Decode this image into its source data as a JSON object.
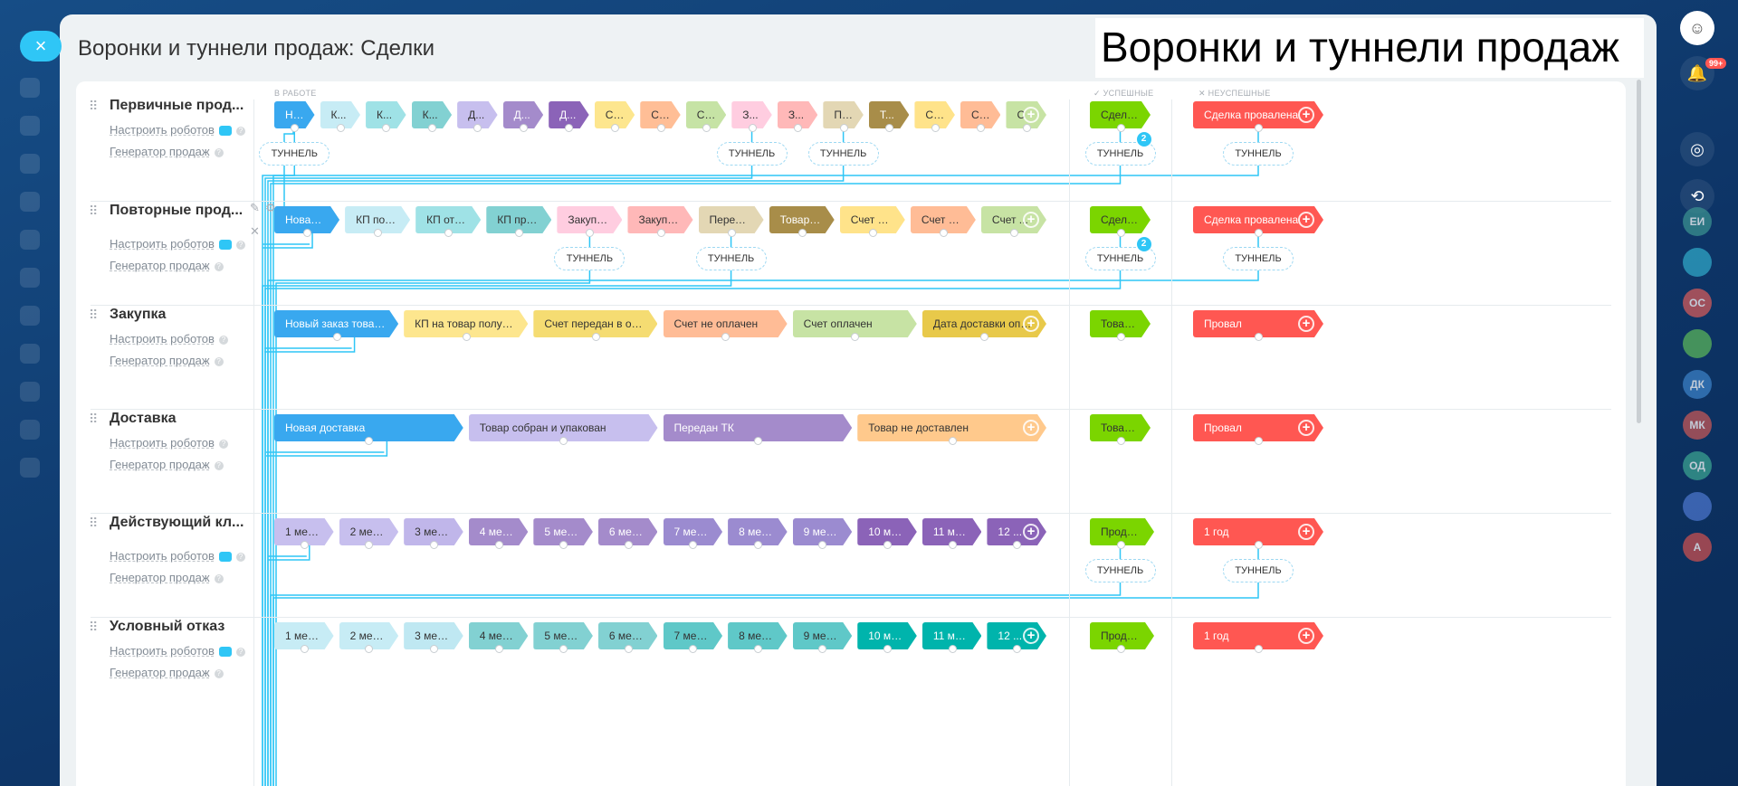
{
  "panel": {
    "title": "Воронки и туннели продаж: Сделки",
    "overlay_title": "Воронки и туннели продаж"
  },
  "columns": {
    "in_work": "В РАБОТЕ",
    "success": "УСПЕШНЫЕ",
    "fail": "НЕУСПЕШНЫЕ"
  },
  "links": {
    "robots": "Настроить роботов",
    "generator": "Генератор продаж"
  },
  "tunnel_label": "ТУННЕЛЬ",
  "bell_count": "99+",
  "right_avatars": [
    {
      "label": "ЕИ",
      "color": "#3a8f8f"
    },
    {
      "label": "",
      "color": "#2fa6c6"
    },
    {
      "label": "ОС",
      "color": "#d05a5a"
    },
    {
      "label": "",
      "color": "#58b359"
    },
    {
      "label": "ДК",
      "color": "#3a7fc4"
    },
    {
      "label": "МК",
      "color": "#c25757"
    },
    {
      "label": "ОД",
      "color": "#3aa08f"
    },
    {
      "label": "",
      "color": "#4a74c9"
    },
    {
      "label": "А",
      "color": "#c85050"
    }
  ],
  "funnels": [
    {
      "name": "Первичные прод...",
      "stages": [
        {
          "label": "Н...",
          "color": "#39a8ef"
        },
        {
          "label": "К...",
          "color": "#c7ecf5"
        },
        {
          "label": "К...",
          "color": "#9fe2e6"
        },
        {
          "label": "К...",
          "color": "#82d1d2"
        },
        {
          "label": "Д...",
          "color": "#c7bfee"
        },
        {
          "label": "Д...",
          "color": "#a48bcb"
        },
        {
          "label": "Д...",
          "color": "#8b63b8"
        },
        {
          "label": "С...",
          "color": "#fde68e"
        },
        {
          "label": "С...",
          "color": "#ffbe96"
        },
        {
          "label": "С...",
          "color": "#c6e3a5"
        },
        {
          "label": "З...",
          "color": "#ffcde0"
        },
        {
          "label": "З...",
          "color": "#ffb8b8"
        },
        {
          "label": "П...",
          "color": "#e3d7b4"
        },
        {
          "label": "Т...",
          "color": "#a88d49"
        },
        {
          "label": "С...",
          "color": "#ffe38a"
        },
        {
          "label": "С...",
          "color": "#ffbc96"
        },
        {
          "label": "С",
          "color": "#c7e3a4"
        }
      ],
      "success": {
        "label": "Сделка ...",
        "color": "#7bd500"
      },
      "fail": {
        "label": "Сделка провалена",
        "color": "#ff5752"
      }
    },
    {
      "name": "Повторные прод...",
      "stages": [
        {
          "label": "Новая ...",
          "color": "#39a8ef"
        },
        {
          "label": "КП под...",
          "color": "#c7ecf5"
        },
        {
          "label": "КП отп...",
          "color": "#9fe2e6"
        },
        {
          "label": "КП при...",
          "color": "#82d1d2"
        },
        {
          "label": "Закупк...",
          "color": "#ffcde0"
        },
        {
          "label": "Закупк...",
          "color": "#ffb8b8"
        },
        {
          "label": "Переда...",
          "color": "#e3d7b4"
        },
        {
          "label": "Товар д...",
          "color": "#a88d49"
        },
        {
          "label": "Счет на...",
          "color": "#ffe38a"
        },
        {
          "label": "Счет на...",
          "color": "#ffbc96"
        },
        {
          "label": "Счет ...",
          "color": "#c7e3a4"
        }
      ],
      "success": {
        "label": "Сделка ...",
        "color": "#7bd500"
      },
      "fail": {
        "label": "Сделка провалена",
        "color": "#ff5752"
      }
    },
    {
      "name": "Закупка",
      "stages": [
        {
          "label": "Новый заказ товара",
          "color": "#39a8ef"
        },
        {
          "label": "КП на товар получено",
          "color": "#fde68e"
        },
        {
          "label": "Счет передан в оплату",
          "color": "#f5dc72"
        },
        {
          "label": "Счет не оплачен",
          "color": "#ffbc96"
        },
        {
          "label": "Счет оплачен",
          "color": "#c7e3a4"
        },
        {
          "label": "Дата доставки опр...",
          "color": "#e8c94a"
        }
      ],
      "success": {
        "label": "Товар н...",
        "color": "#7bd500"
      },
      "fail": {
        "label": "Провал",
        "color": "#ff5752"
      }
    },
    {
      "name": "Доставка",
      "stages": [
        {
          "label": "Новая доставка",
          "color": "#39a8ef"
        },
        {
          "label": "Товар собран и упакован",
          "color": "#c7bfee"
        },
        {
          "label": "Передан ТК",
          "color": "#a48bcb"
        },
        {
          "label": "Товар не доставлен",
          "color": "#ffc98c"
        }
      ],
      "success": {
        "label": "Товар д...",
        "color": "#7bd500"
      },
      "fail": {
        "label": "Провал",
        "color": "#ff5752"
      }
    },
    {
      "name": "Действующий кл...",
      "stages": [
        {
          "label": "1 месяц",
          "color": "#c7bfee"
        },
        {
          "label": "2 месяц",
          "color": "#c7bfee"
        },
        {
          "label": "3 месяц",
          "color": "#c0b6ea"
        },
        {
          "label": "4 месяц",
          "color": "#a48bcb"
        },
        {
          "label": "5 месяц",
          "color": "#a48bcb"
        },
        {
          "label": "6 месяц",
          "color": "#a48bcb"
        },
        {
          "label": "7 месяц",
          "color": "#9b8bd0"
        },
        {
          "label": "8 месяц",
          "color": "#9b8bd0"
        },
        {
          "label": "9 месяц",
          "color": "#9b8bd0"
        },
        {
          "label": "10 мес...",
          "color": "#8b63b8"
        },
        {
          "label": "11 мес...",
          "color": "#8b63b8"
        },
        {
          "label": "12 ...",
          "color": "#8b63b8"
        }
      ],
      "success": {
        "label": "Продажа",
        "color": "#7bd500"
      },
      "fail": {
        "label": "1 год",
        "color": "#ff5752"
      }
    },
    {
      "name": "Условный отказ",
      "stages": [
        {
          "label": "1 месяц",
          "color": "#c7ecf5"
        },
        {
          "label": "2 месяц",
          "color": "#c7ecf5"
        },
        {
          "label": "3 месяц",
          "color": "#bfe8f2"
        },
        {
          "label": "4 месяц",
          "color": "#82d1d2"
        },
        {
          "label": "5 месяц",
          "color": "#82d1d2"
        },
        {
          "label": "6 месяц",
          "color": "#82d1d2"
        },
        {
          "label": "7 месяц",
          "color": "#5fc8c8"
        },
        {
          "label": "8 месяц",
          "color": "#5fc8c8"
        },
        {
          "label": "9 месяц",
          "color": "#5fc8c8"
        },
        {
          "label": "10 мес...",
          "color": "#00b4ac"
        },
        {
          "label": "11 мес...",
          "color": "#00b4ac"
        },
        {
          "label": "12 ...",
          "color": "#00b4ac"
        }
      ],
      "success": {
        "label": "Продажа",
        "color": "#7bd500"
      },
      "fail": {
        "label": "1 год",
        "color": "#ff5752"
      }
    }
  ],
  "tunnels": [
    {
      "row": 0,
      "stage": "0",
      "badge": ""
    },
    {
      "row": 0,
      "stage": "10",
      "badge": ""
    },
    {
      "row": 0,
      "stage": "12",
      "badge": ""
    },
    {
      "row": 0,
      "stage": "success",
      "badge": "2"
    },
    {
      "row": 0,
      "stage": "fail",
      "badge": ""
    },
    {
      "row": 1,
      "stage": "4",
      "badge": ""
    },
    {
      "row": 1,
      "stage": "6",
      "badge": ""
    },
    {
      "row": 1,
      "stage": "success",
      "badge": "2"
    },
    {
      "row": 1,
      "stage": "fail",
      "badge": ""
    },
    {
      "row": 4,
      "stage": "success",
      "badge": ""
    },
    {
      "row": 4,
      "stage": "fail",
      "badge": ""
    }
  ]
}
